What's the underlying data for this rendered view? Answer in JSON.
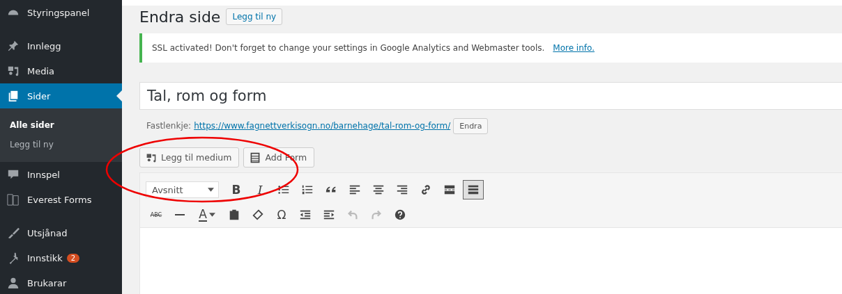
{
  "sidebar": {
    "items": [
      {
        "label": "Styringspanel",
        "selected": false
      },
      {
        "label": "Innlegg",
        "selected": false
      },
      {
        "label": "Media",
        "selected": false
      },
      {
        "label": "Sider",
        "selected": true,
        "children": [
          {
            "label": "Alle sider",
            "selected": true
          },
          {
            "label": "Legg til ny",
            "selected": false
          }
        ]
      },
      {
        "label": "Innspel",
        "selected": false
      },
      {
        "label": "Everest Forms",
        "selected": false
      },
      {
        "label": "Utsjånad",
        "selected": false
      },
      {
        "label": "Innstikk",
        "selected": false,
        "badge": "2"
      },
      {
        "label": "Brukarar",
        "selected": false
      }
    ]
  },
  "page": {
    "title": "Endra side",
    "add_button": "Legg til ny",
    "notice": {
      "text": "SSL activated!  Don't forget to change your settings in Google Analytics and Webmaster tools.",
      "link": "More info."
    },
    "post_title": "Tal, rom og form",
    "permalink": {
      "label": "Fastlenkje:",
      "url": "https://www.fagnettverkisogn.no/barnehage/tal-rom-og-form/",
      "button": "Endra"
    },
    "media_buttons": [
      {
        "label": "Legg til medium"
      },
      {
        "label": "Add Form"
      }
    ],
    "format_select": "Avsnitt",
    "toolbar_rows": [
      [
        {
          "kind": "bold",
          "glyph": "B"
        },
        {
          "kind": "italic",
          "glyph": "I"
        },
        {
          "kind": "ul"
        },
        {
          "kind": "ol"
        },
        {
          "kind": "quote"
        },
        {
          "kind": "alignleft"
        },
        {
          "kind": "aligncenter"
        },
        {
          "kind": "alignright"
        },
        {
          "kind": "link"
        },
        {
          "kind": "more"
        },
        {
          "kind": "toggle",
          "pressed": true
        }
      ],
      [
        {
          "kind": "strike",
          "glyph": "ABC"
        },
        {
          "kind": "hr"
        },
        {
          "kind": "color",
          "glyph": "A"
        },
        {
          "kind": "paste"
        },
        {
          "kind": "eraser"
        },
        {
          "kind": "omega",
          "glyph": "Ω"
        },
        {
          "kind": "outdent"
        },
        {
          "kind": "indent"
        },
        {
          "kind": "undo",
          "disabled": true
        },
        {
          "kind": "redo",
          "disabled": true
        },
        {
          "kind": "help"
        }
      ]
    ]
  }
}
